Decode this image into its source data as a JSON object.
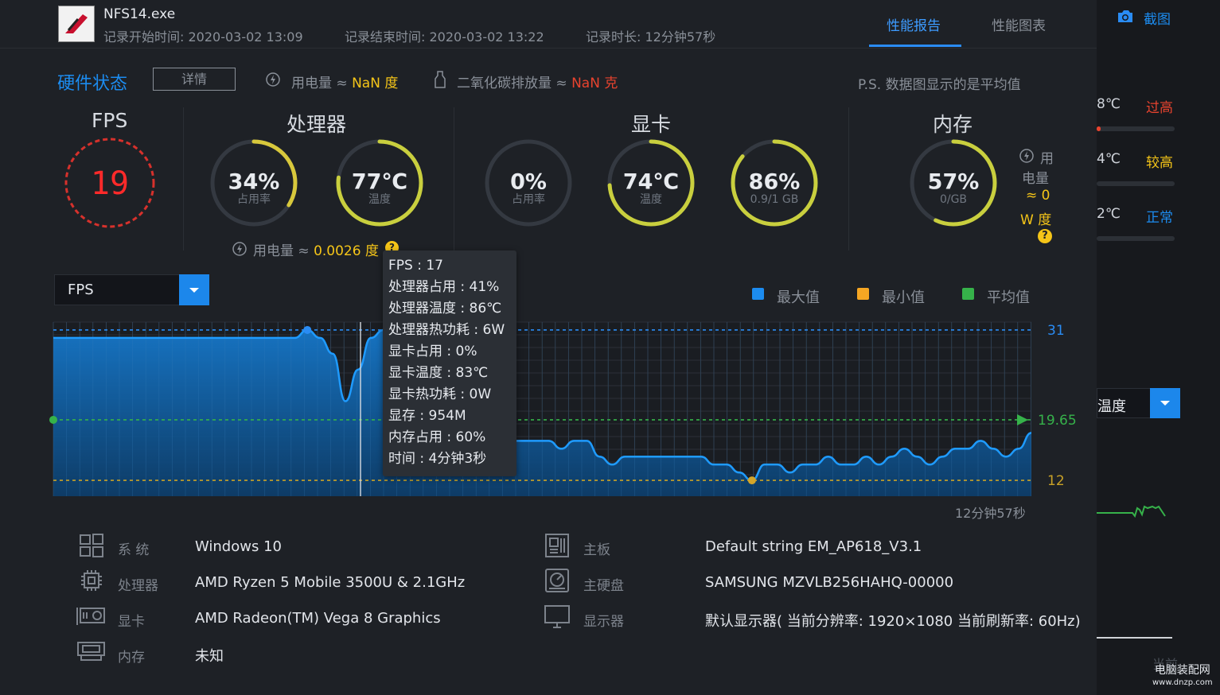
{
  "header": {
    "app_name": "NFS14.exe",
    "record_start": "记录开始时间: 2020-03-02 13:09",
    "record_end": "记录结束时间: 2020-03-02 13:22",
    "record_duration": "记录时长: 12分钟57秒",
    "tabs": [
      "性能报告",
      "性能图表"
    ],
    "screenshot_label": "截图"
  },
  "hardware": {
    "title": "硬件状态",
    "detail_button": "详情",
    "power_label": "用电量 ≈ ",
    "power_value": "NaN 度",
    "co2_label": "二氧化碳排放量 ≈ ",
    "co2_value": "NaN 克",
    "note": "P.S. 数据图显示的是平均值"
  },
  "fps": {
    "title": "FPS",
    "value": "19"
  },
  "cpu": {
    "title": "处理器",
    "usage": "34%",
    "usage_label": "占用率",
    "usage_fraction": 0.34,
    "temp": "77℃",
    "temp_label": "温度",
    "temp_fraction": 0.77,
    "power_label": "用电量 ≈ ",
    "power_value": "0.0026 度"
  },
  "gpu": {
    "title": "显卡",
    "usage": "0%",
    "usage_label": "占用率",
    "usage_fraction": 0,
    "temp": "74℃",
    "temp_label": "温度",
    "temp_fraction": 0.74,
    "vram": "86%",
    "vram_label": "0.9/1 GB",
    "vram_fraction": 0.86
  },
  "memory": {
    "title": "内存",
    "usage": "57%",
    "usage_label": "0/GB",
    "usage_fraction": 0.57,
    "power_lines": [
      "用",
      "电量",
      "≈ 0",
      "W 度"
    ]
  },
  "side_panel": {
    "temps": [
      {
        "value": "8℃",
        "status": "过高",
        "color": "#e8432e"
      },
      {
        "value": "4℃",
        "status": "较高",
        "color": "#f5c518"
      },
      {
        "value": "2℃",
        "status": "正常",
        "color": "#2a8cf4"
      }
    ],
    "dropdown_value": "温度",
    "bottom_label": "当前"
  },
  "chart_controls": {
    "metric_dropdown": "FPS",
    "legend": [
      {
        "name": "最大值",
        "color": "#1c8cf0"
      },
      {
        "name": "最小值",
        "color": "#f5a623"
      },
      {
        "name": "平均值",
        "color": "#36b24a"
      }
    ],
    "duration_label": "12分钟57秒"
  },
  "chart_data": {
    "type": "area",
    "x": [
      0,
      10,
      20,
      30,
      40,
      50,
      60,
      70,
      80,
      90,
      100,
      110,
      120,
      130,
      140,
      150,
      160,
      170,
      180,
      190,
      200,
      210,
      220,
      230,
      240,
      250,
      260,
      270,
      280,
      290,
      300,
      310,
      320,
      330,
      340,
      350,
      360,
      370,
      380,
      390,
      400,
      410,
      420,
      430,
      440,
      450,
      460,
      470,
      480,
      490,
      500,
      510,
      520,
      530,
      540,
      550,
      560,
      570,
      580,
      590,
      600,
      610,
      620,
      630,
      640,
      650,
      660,
      670,
      680,
      690,
      700,
      710,
      720,
      730,
      740,
      750,
      760,
      770
    ],
    "values": [
      30,
      30,
      30,
      30,
      30,
      30,
      30,
      30,
      30,
      30,
      30,
      30,
      30,
      30,
      30,
      30,
      30,
      30,
      30,
      30,
      31,
      30,
      28,
      22,
      26,
      30,
      31,
      30,
      30,
      18,
      18,
      18,
      17,
      17,
      16,
      17,
      17,
      17,
      17,
      17,
      16,
      17,
      17,
      15,
      14,
      15,
      15,
      15,
      15,
      15,
      15,
      15,
      14,
      14,
      13,
      12,
      14,
      14,
      13,
      14,
      14,
      15,
      14,
      14,
      15,
      14,
      15,
      16,
      15,
      14,
      15,
      16,
      16,
      17,
      16,
      15,
      16,
      18
    ],
    "max": 31,
    "min": 12,
    "avg": 19.65,
    "ylim": [
      10,
      32
    ]
  },
  "tooltip": {
    "lines": [
      "FPS : 17",
      "处理器占用 : 41%",
      "处理器温度 : 86℃",
      "处理器热功耗 : 6W",
      "显卡占用 : 0%",
      "显卡温度 : 83℃",
      "显卡热功耗 : 0W",
      "显存 : 954M",
      "内存占用 : 60%",
      "时间 : 4分钟3秒"
    ]
  },
  "system_info": {
    "left": [
      {
        "label": "系  统",
        "value": "Windows 10",
        "icon": "windows-icon"
      },
      {
        "label": "处理器",
        "value": "AMD Ryzen 5 Mobile 3500U & 2.1GHz",
        "icon": "cpu-icon"
      },
      {
        "label": "显卡",
        "value": "AMD Radeon(TM) Vega 8 Graphics",
        "icon": "gpu-icon"
      },
      {
        "label": "内存",
        "value": "未知",
        "icon": "memory-icon"
      }
    ],
    "right": [
      {
        "label": "主板",
        "value": "Default string EM_AP618_V3.1",
        "icon": "motherboard-icon"
      },
      {
        "label": "主硬盘",
        "value": "SAMSUNG MZVLB256HAHQ-00000",
        "icon": "disk-icon"
      },
      {
        "label": "显示器",
        "value": "默认显示器( 当前分辨率: 1920×1080 当前刷新率: 60Hz)",
        "icon": "monitor-icon"
      }
    ]
  },
  "watermark": {
    "site": "电脑装配网",
    "url": "www.dnzp.com"
  }
}
